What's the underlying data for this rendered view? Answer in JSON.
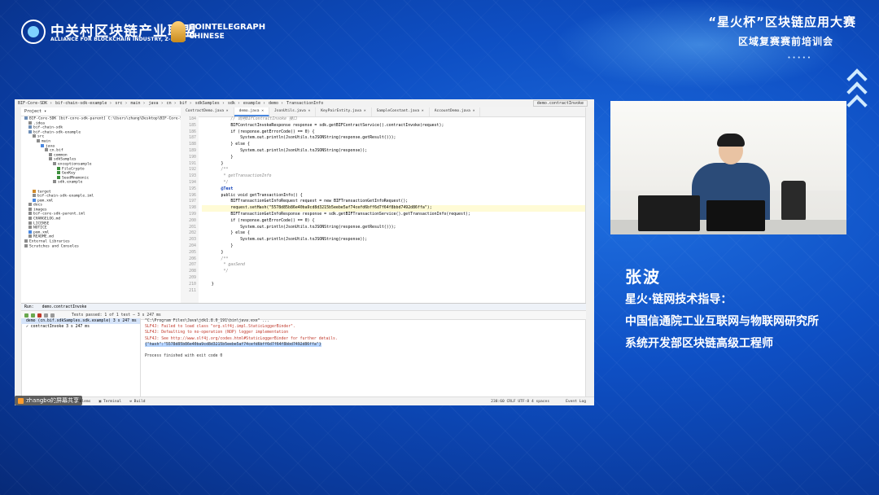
{
  "header": {
    "alliance_cn": "中关村区块链产业联盟",
    "alliance_en": "ALLIANCE FOR BLOCKCHAIN INDUSTRY, Z-PARK",
    "partner_name": "COINTELEGRAPH",
    "partner_sub": "CHINESE",
    "event_title": "“星火杯”区块链应用大赛",
    "event_subtitle": "区域复赛赛前培训会",
    "dots": "•••••"
  },
  "ide": {
    "breadcrumb": [
      "BIF-Core-SDK",
      "bif-chain-sdk-example",
      "src",
      "main",
      "java",
      "cn",
      "bif",
      "sdkSamples",
      "sdk",
      "example",
      "demo",
      "TransactionInfo"
    ],
    "run_config": "demo.contractInvoke",
    "project_header": "Project ▾",
    "tree": [
      {
        "label": "BIF-Core-SDK [bif-core-sdk-parent]  C:\\Users\\zhang\\Desktop\\BIF-Core-SDK",
        "indent": 0,
        "color": "#6e8fb8"
      },
      {
        "label": ".idea",
        "indent": 1,
        "color": "#8c8c8c"
      },
      {
        "label": "bif-chain-sdk",
        "indent": 1,
        "color": "#6e8fb8"
      },
      {
        "label": "bif-chain-sdk-example",
        "indent": 1,
        "color": "#6e8fb8"
      },
      {
        "label": "src",
        "indent": 2,
        "color": "#8c8c8c"
      },
      {
        "label": "main",
        "indent": 3,
        "color": "#8c8c8c"
      },
      {
        "label": "java",
        "indent": 4,
        "color": "#4a88e0"
      },
      {
        "label": "cn.bif",
        "indent": 5,
        "color": "#8c8c8c"
      },
      {
        "label": "common",
        "indent": 6,
        "color": "#8c8c8c"
      },
      {
        "label": "sdkSamples",
        "indent": 6,
        "color": "#8c8c8c"
      },
      {
        "label": "exceptionsample",
        "indent": 7,
        "color": "#8c8c8c"
      },
      {
        "label": "FileCrypto",
        "indent": 8,
        "color": "#3d8f3d"
      },
      {
        "label": "GenKey",
        "indent": 8,
        "color": "#3d8f3d"
      },
      {
        "label": "SeedMnemonic",
        "indent": 8,
        "color": "#3d8f3d"
      },
      {
        "label": "sdk.example",
        "indent": 7,
        "color": "#8c8c8c"
      },
      {
        "label": "",
        "indent": 0,
        "color": "#fff"
      },
      {
        "label": "target",
        "indent": 2,
        "color": "#d08a2a"
      },
      {
        "label": "bif-chain-sdk-example.iml",
        "indent": 2,
        "color": "#8c8c8c"
      },
      {
        "label": "pom.xml",
        "indent": 2,
        "color": "#4a88e0"
      },
      {
        "label": "docs",
        "indent": 1,
        "color": "#8c8c8c"
      },
      {
        "label": "images",
        "indent": 1,
        "color": "#8c8c8c"
      },
      {
        "label": "bif-core-sdk-parent.iml",
        "indent": 1,
        "color": "#8c8c8c"
      },
      {
        "label": "CHANGELOG.md",
        "indent": 1,
        "color": "#8c8c8c"
      },
      {
        "label": "LICENSE",
        "indent": 1,
        "color": "#8c8c8c"
      },
      {
        "label": "NOTICE",
        "indent": 1,
        "color": "#8c8c8c"
      },
      {
        "label": "pom.xml",
        "indent": 1,
        "color": "#4a88e0"
      },
      {
        "label": "README.md",
        "indent": 1,
        "color": "#8c8c8c"
      },
      {
        "label": "External Libraries",
        "indent": 0,
        "color": "#8c8c8c"
      },
      {
        "label": "Scratches and Consoles",
        "indent": 0,
        "color": "#8c8c8c"
      }
    ],
    "tabs": [
      "ContractDemo.java",
      "demo.java",
      "JsonUtils.java",
      "KeyPairEntity.java",
      "SampleConstant.java",
      "AccountDemo.java"
    ],
    "active_tab": 1,
    "line_numbers": [
      "184",
      "185",
      "186",
      "187",
      "188",
      "189",
      "190",
      "191",
      "192",
      "193",
      "194",
      "195",
      "196",
      "197",
      "198",
      "199",
      "200",
      "201",
      "202",
      "203",
      "204",
      "205",
      "206",
      "207",
      "208",
      "209",
      "210",
      "211"
    ],
    "code_lines": [
      {
        "text": "            // 调用BIFContractInvoke 接口",
        "type": "cm"
      },
      {
        "text": "            BIFContractInvokeResponse response = sdk.getBIFContractService().contractInvoke(request);",
        "type": "n"
      },
      {
        "text": "            if (response.getErrorCode() == 0) {",
        "type": "n"
      },
      {
        "text": "                System.out.println(JsonUtils.toJSONString(response.getResult()));",
        "type": "n"
      },
      {
        "text": "            } else {",
        "type": "n"
      },
      {
        "text": "                System.out.println(JsonUtils.toJSONString(response));",
        "type": "n"
      },
      {
        "text": "            }",
        "type": "n"
      },
      {
        "text": "        }",
        "type": "n"
      },
      {
        "text": "        /**",
        "type": "cm"
      },
      {
        "text": "         * getTransactionInfo",
        "type": "cm"
      },
      {
        "text": "         */",
        "type": "cm"
      },
      {
        "text": "        @Test",
        "type": "kw"
      },
      {
        "text": "        public void getTransactionInfo() {",
        "type": "n"
      },
      {
        "text": "            BIFTransactionGetInfoRequest request = new BIFTransactionGetInfoRequest();",
        "type": "n"
      },
      {
        "text": "            request.setHash(\"5578d85b86e40ba9cd8d3215b5eebe5af74cefd6bff6d7f64f8bbd7492d86ffa\");",
        "type": "hl"
      },
      {
        "text": "            BIFTransactionGetInfoResponse response = sdk.getBIFTransactionService().getTransactionInfo(request);",
        "type": "n"
      },
      {
        "text": "            if (response.getErrorCode() == 0) {",
        "type": "n"
      },
      {
        "text": "                System.out.println(JsonUtils.toJSONString(response.getResult()));",
        "type": "n"
      },
      {
        "text": "            } else {",
        "type": "n"
      },
      {
        "text": "                System.out.println(JsonUtils.toJSONString(response));",
        "type": "n"
      },
      {
        "text": "            }",
        "type": "n"
      },
      {
        "text": "        }",
        "type": "n"
      },
      {
        "text": "        /**",
        "type": "cm"
      },
      {
        "text": "         * gasSend",
        "type": "cm"
      },
      {
        "text": "         */",
        "type": "cm"
      },
      {
        "text": "",
        "type": "n"
      },
      {
        "text": "    }",
        "type": "n"
      },
      {
        "text": "",
        "type": "n"
      }
    ],
    "run_tab": "Run:",
    "run_cfg_tab": "demo.contractInvoke",
    "test_status": "Tests passed: 1 of 1 test – 3 s 247 ms",
    "run_tree": [
      {
        "label": "demo (cn.bif.sdkSamples.sdk.example)   3 s 247 ms",
        "sel": true
      },
      {
        "label": "    ✓ contractInvoke                          3 s 247 ms",
        "sel": false
      }
    ],
    "console": [
      {
        "text": "\"C:\\Program Files\\Java\\jdk1.8.0_191\\bin\\java.exe\" ...",
        "type": "n"
      },
      {
        "text": "SLF4J: Failed to load class \"org.slf4j.impl.StaticLoggerBinder\".",
        "type": "err"
      },
      {
        "text": "SLF4J: Defaulting to no-operation (NOP) logger implementation",
        "type": "err"
      },
      {
        "text": "SLF4J: See http://www.slf4j.org/codes.html#StaticLoggerBinder for further details.",
        "type": "err"
      },
      {
        "text": "{\"hash\":\"5578d85b86e40ba9cd8d3215b5eebe5af74cefd6bff6d7f64f8bbd7492d86ffa\"}",
        "type": "sel"
      },
      {
        "text": "",
        "type": "n"
      },
      {
        "text": "Process finished with exit code 0",
        "type": "n"
      }
    ],
    "statusbar": [
      "▶ Run",
      "☰ TODO",
      "⚠ Problems",
      "▣ Terminal",
      "⚒ Build"
    ],
    "statusbar_right": "238:60  CRLF  UTF-8  4 spaces",
    "event_log": "Event Log"
  },
  "share_badge": "zhangbo的屏幕共享",
  "speaker": {
    "name": "张波",
    "role": "星火·链网技术指导：",
    "org": "中国信通院工业互联网与物联网研究所",
    "title": "系统开发部区块链高级工程师"
  }
}
